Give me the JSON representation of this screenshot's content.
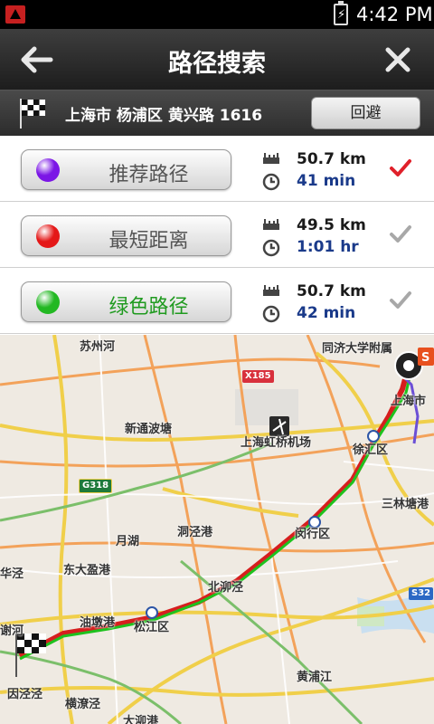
{
  "status_bar": {
    "time": "4:42 PM"
  },
  "header": {
    "title": "路径搜索"
  },
  "destination": {
    "address": "上海市 杨浦区 黄兴路 1616",
    "avoid_label": "回避"
  },
  "routes": [
    {
      "label": "推荐路径",
      "distance": "50.7 km",
      "duration": "41 min",
      "dot_color": "#7b16e6",
      "label_color": "#555555",
      "selected": true,
      "check_color": "#e0202a"
    },
    {
      "label": "最短距离",
      "distance": "49.5 km",
      "duration": "1:01 hr",
      "dot_color": "#e41818",
      "label_color": "#555555",
      "selected": false,
      "check_color": "#a8a8a8"
    },
    {
      "label": "绿色路径",
      "distance": "50.7 km",
      "duration": "42 min",
      "dot_color": "#22b822",
      "label_color": "#1f9a1f",
      "selected": false,
      "check_color": "#a8a8a8"
    }
  ],
  "map": {
    "labels": {
      "suzhou_river": "苏州河",
      "tongji": "同济大学附属",
      "shanghai": "上海市",
      "xintong": "新通波塘",
      "hongqiao": "上海虹桥机场",
      "xuhui": "徐汇区",
      "sanlin": "三林塘港",
      "dongjing": "洞泾港",
      "yuehu": "月湖",
      "minhang": "闵行区",
      "huajing": "华泾",
      "dongdayingang": "东大盈港",
      "beishen": "北泖泾",
      "youdungang": "油墩港",
      "songjiang": "松江区",
      "xiehe": "谢河",
      "huangpu": "黄浦江",
      "yinjing": "因泾泾",
      "gangjinggang": "横潦泾",
      "dazhen": "大泖港"
    },
    "shields": {
      "x185": "X185",
      "g318": "G318",
      "s32": "S32"
    }
  }
}
